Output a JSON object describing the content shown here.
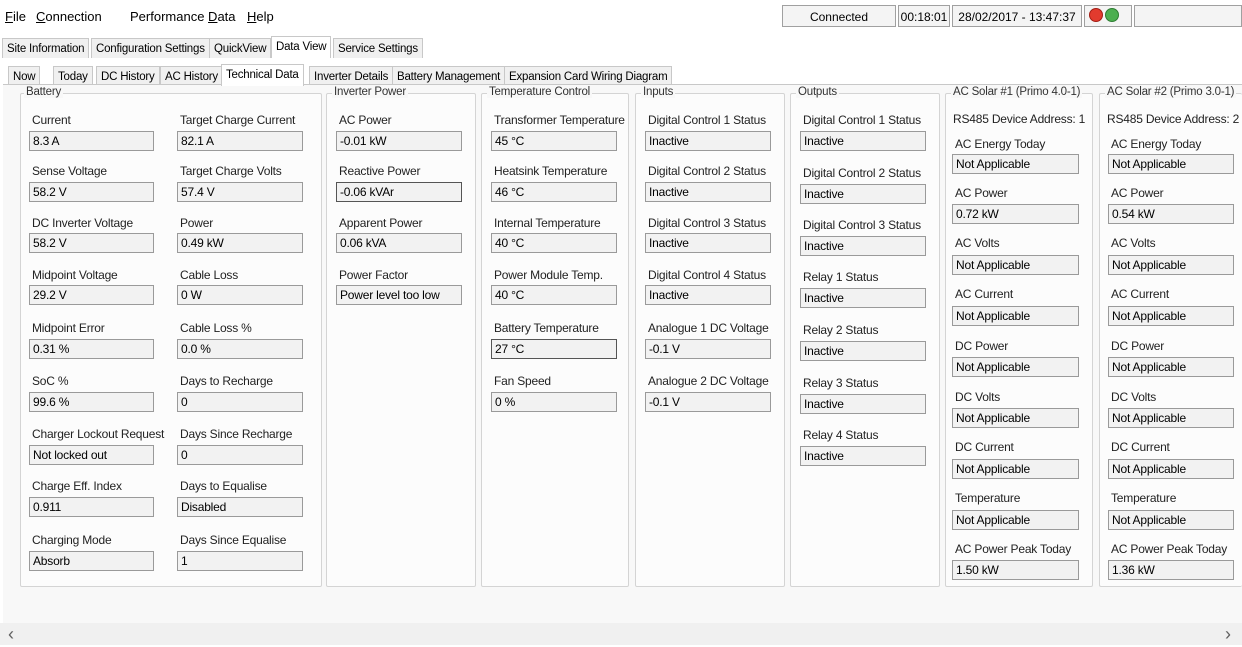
{
  "menu": [
    "File",
    "Connection",
    "Performance Data",
    "Help"
  ],
  "status": {
    "connection": "Connected",
    "elapsed": "00:18:01",
    "datetime": "28/02/2017 - 13:47:37",
    "error_icon_color": "#e23b2e",
    "ok_icon_color": "#4caf50"
  },
  "top_tabs": [
    "Site Information",
    "Configuration Settings",
    "QuickView",
    "Data View",
    "Service Settings"
  ],
  "sub_tabs": [
    "Now",
    "Today",
    "DC History",
    "AC History",
    "Technical Data",
    "Inverter Details",
    "Battery Management",
    "Expansion Card Wiring Diagram"
  ],
  "battery": {
    "title": "Battery",
    "fields": [
      {
        "label": "Current",
        "value": "8.3 A"
      },
      {
        "label": "Target Charge Current",
        "value": "82.1 A"
      },
      {
        "label": "Sense Voltage",
        "value": "58.2 V"
      },
      {
        "label": "Target Charge Volts",
        "value": "57.4 V"
      },
      {
        "label": "DC Inverter Voltage",
        "value": "58.2 V"
      },
      {
        "label": "Power",
        "value": "0.49 kW"
      },
      {
        "label": "Midpoint Voltage",
        "value": "29.2 V"
      },
      {
        "label": "Cable Loss",
        "value": "0 W"
      },
      {
        "label": "Midpoint Error",
        "value": "0.31 %"
      },
      {
        "label": "Cable Loss %",
        "value": "0.0 %"
      },
      {
        "label": "SoC %",
        "value": "99.6 %"
      },
      {
        "label": "Days to Recharge",
        "value": "0"
      },
      {
        "label": "Charger Lockout Request",
        "value": "Not locked out"
      },
      {
        "label": "Days Since Recharge",
        "value": "0"
      },
      {
        "label": "Charge Eff. Index",
        "value": "0.911"
      },
      {
        "label": "Days to Equalise",
        "value": "Disabled"
      },
      {
        "label": "Charging Mode",
        "value": "Absorb"
      },
      {
        "label": "Days Since Equalise",
        "value": "1"
      }
    ]
  },
  "inverter_power": {
    "title": "Inverter Power",
    "fields": [
      {
        "label": "AC Power",
        "value": "-0.01 kW"
      },
      {
        "label": "Reactive Power",
        "value": "-0.06 kVAr"
      },
      {
        "label": "Apparent Power",
        "value": "0.06 kVA"
      },
      {
        "label": "Power Factor",
        "value": "Power level too low"
      }
    ]
  },
  "temperature": {
    "title": "Temperature Control",
    "fields": [
      {
        "label": "Transformer Temperature",
        "value": "45 °C"
      },
      {
        "label": "Heatsink Temperature",
        "value": "46 °C"
      },
      {
        "label": "Internal Temperature",
        "value": "40 °C"
      },
      {
        "label": "Power Module Temp.",
        "value": "40 °C"
      },
      {
        "label": "Battery Temperature",
        "value": "27 °C"
      },
      {
        "label": "Fan Speed",
        "value": "0 %"
      }
    ]
  },
  "inputs": {
    "title": "Inputs",
    "fields": [
      {
        "label": "Digital Control 1 Status",
        "value": "Inactive"
      },
      {
        "label": "Digital Control 2 Status",
        "value": "Inactive"
      },
      {
        "label": "Digital Control 3 Status",
        "value": "Inactive"
      },
      {
        "label": "Digital Control 4 Status",
        "value": "Inactive"
      },
      {
        "label": "Analogue 1 DC Voltage",
        "value": "-0.1 V"
      },
      {
        "label": "Analogue 2 DC Voltage",
        "value": "-0.1 V"
      }
    ]
  },
  "outputs": {
    "title": "Outputs",
    "fields": [
      {
        "label": "Digital Control 1 Status",
        "value": "Inactive"
      },
      {
        "label": "Digital Control 2 Status",
        "value": "Inactive"
      },
      {
        "label": "Digital Control 3 Status",
        "value": "Inactive"
      },
      {
        "label": "Relay 1 Status",
        "value": "Inactive"
      },
      {
        "label": "Relay 2 Status",
        "value": "Inactive"
      },
      {
        "label": "Relay 3 Status",
        "value": "Inactive"
      },
      {
        "label": "Relay 4 Status",
        "value": "Inactive"
      }
    ]
  },
  "solar1": {
    "title": "AC Solar #1 (Primo 4.0-1)",
    "address": "RS485 Device Address: 1",
    "fields": [
      {
        "label": "AC Energy Today",
        "value": "Not Applicable"
      },
      {
        "label": "AC Power",
        "value": "0.72 kW"
      },
      {
        "label": "AC Volts",
        "value": "Not Applicable"
      },
      {
        "label": "AC Current",
        "value": "Not Applicable"
      },
      {
        "label": "DC Power",
        "value": "Not Applicable"
      },
      {
        "label": "DC Volts",
        "value": "Not Applicable"
      },
      {
        "label": "DC Current",
        "value": "Not Applicable"
      },
      {
        "label": "Temperature",
        "value": "Not Applicable"
      },
      {
        "label": "AC Power Peak Today",
        "value": "1.50 kW"
      }
    ]
  },
  "solar2": {
    "title": "AC Solar #2 (Primo 3.0-1)",
    "address": "RS485 Device Address: 2",
    "fields": [
      {
        "label": "AC Energy Today",
        "value": "Not Applicable"
      },
      {
        "label": "AC Power",
        "value": "0.54 kW"
      },
      {
        "label": "AC Volts",
        "value": "Not Applicable"
      },
      {
        "label": "AC Current",
        "value": "Not Applicable"
      },
      {
        "label": "DC Power",
        "value": "Not Applicable"
      },
      {
        "label": "DC Volts",
        "value": "Not Applicable"
      },
      {
        "label": "DC Current",
        "value": "Not Applicable"
      },
      {
        "label": "Temperature",
        "value": "Not Applicable"
      },
      {
        "label": "AC Power Peak Today",
        "value": "1.36 kW"
      }
    ]
  },
  "scroll": {
    "left_arrow": "‹",
    "right_arrow": "›"
  }
}
